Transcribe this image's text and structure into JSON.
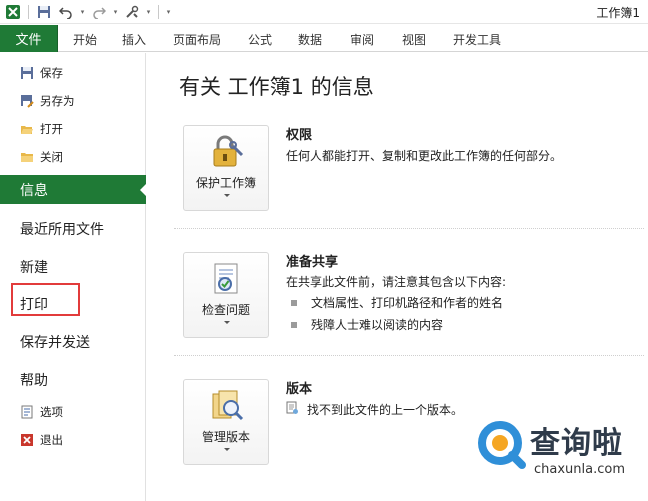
{
  "window": {
    "title": "工作簿1"
  },
  "ribbon": {
    "file_tab": "文件",
    "tabs": [
      "开始",
      "插入",
      "页面布局",
      "公式",
      "数据",
      "审阅",
      "视图",
      "开发工具"
    ]
  },
  "backstage": {
    "commands_top": [
      {
        "label": "保存",
        "icon": "save-icon"
      },
      {
        "label": "另存为",
        "icon": "save-as-icon"
      },
      {
        "label": "打开",
        "icon": "open-folder-icon"
      },
      {
        "label": "关闭",
        "icon": "close-folder-icon"
      }
    ],
    "active": "信息",
    "nav": [
      "最近所用文件",
      "新建",
      "打印",
      "保存并发送",
      "帮助"
    ],
    "commands_bottom": [
      {
        "label": "选项",
        "icon": "options-icon"
      },
      {
        "label": "退出",
        "icon": "exit-icon"
      }
    ]
  },
  "info": {
    "heading": "有关 工作簿1 的信息",
    "sections": [
      {
        "button": "保护工作簿",
        "title": "权限",
        "desc": "任何人都能打开、复制和更改此工作簿的任何部分。"
      },
      {
        "button": "检查问题",
        "title": "准备共享",
        "desc": "在共享此文件前，请注意其包含以下内容:",
        "bullets": [
          "文档属性、打印机路径和作者的姓名",
          "残障人士难以阅读的内容"
        ]
      },
      {
        "button": "管理版本",
        "title": "版本",
        "desc": "找不到此文件的上一个版本。"
      }
    ]
  },
  "watermark": {
    "brand": "查询啦",
    "url": "chaxunla.com"
  },
  "colors": {
    "accent": "#1f7a36",
    "highlight_box": "#e23b3b"
  }
}
